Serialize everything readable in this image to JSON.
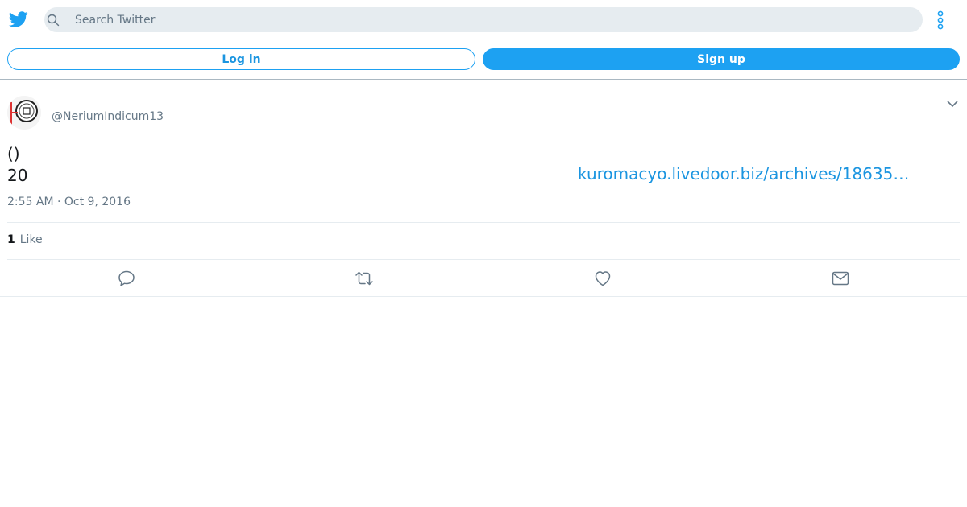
{
  "header": {
    "logo_icon": "twitter-bird-icon",
    "search": {
      "placeholder": "Search Twitter",
      "value": ""
    },
    "more_icon": "more-vertical-icon"
  },
  "auth": {
    "login_label": "Log in",
    "signup_label": "Sign up"
  },
  "tweet": {
    "avatar_icon": "avatar-image",
    "handle": "@NeriumIndicum13",
    "text_line1": "()",
    "text_line2": "20",
    "link_text": "kuromacyo.livedoor.biz/archives/18635…",
    "timestamp": "2:55 AM · Oct 9, 2016",
    "likes_count": "1",
    "likes_label": "Like"
  },
  "actions": [
    "reply-icon",
    "retweet-icon",
    "like-icon",
    "share-mail-icon"
  ],
  "colors": {
    "accent": "#1da1f2",
    "link": "#1b95e0",
    "muted": "#657786",
    "search_bg": "#e6ecf0"
  }
}
